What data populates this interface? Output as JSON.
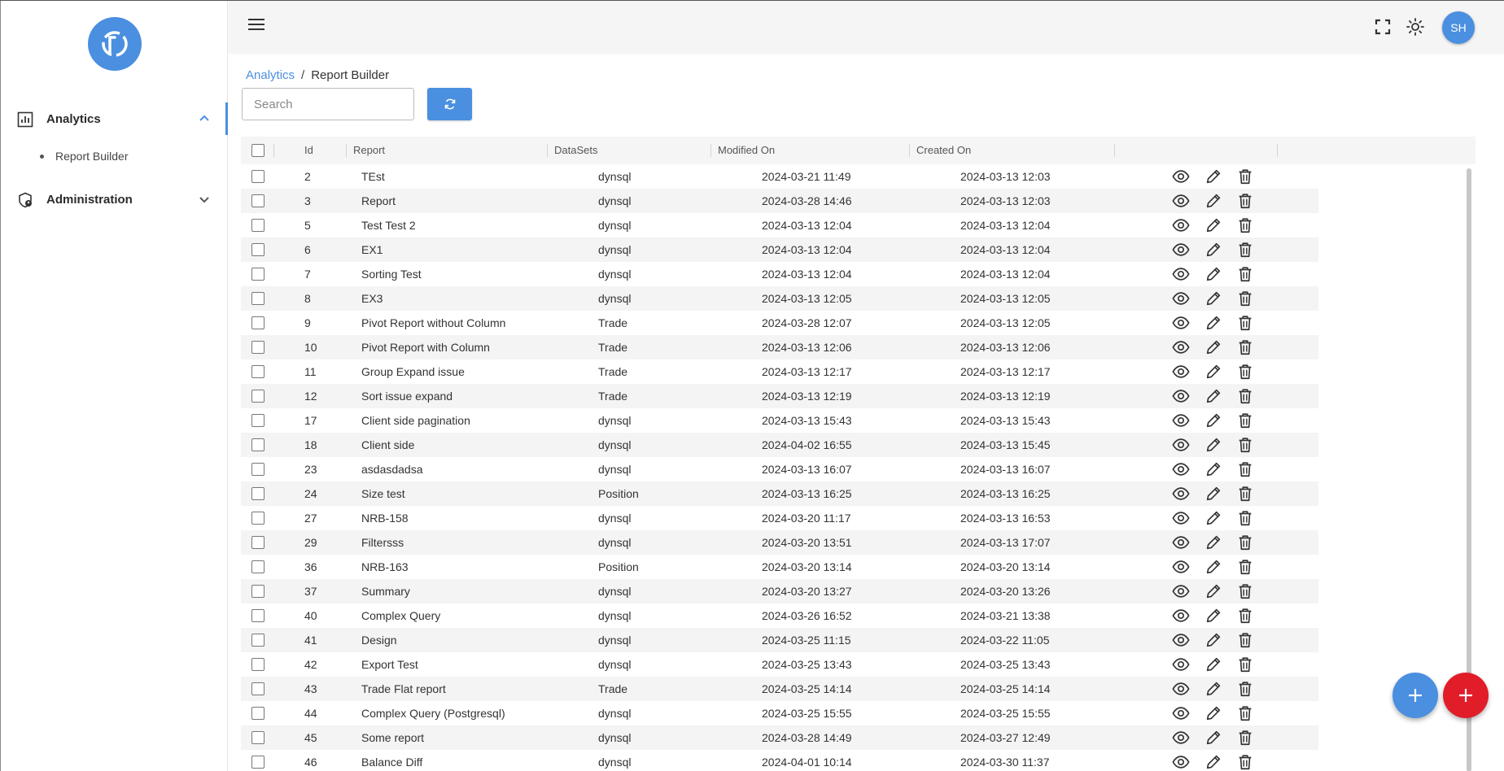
{
  "app": {
    "logo_icon": "report-logo-icon",
    "accent_color": "#4a8fe0",
    "danger_color": "#e11d2a"
  },
  "sidebar": {
    "items": [
      {
        "label": "Analytics",
        "icon": "bar-chart-icon",
        "expanded": true,
        "sub": [
          {
            "label": "Report Builder"
          }
        ]
      },
      {
        "label": "Administration",
        "icon": "shield-user-icon",
        "expanded": false
      }
    ]
  },
  "header": {
    "avatar_initials": "SH",
    "icons": [
      "menu-icon",
      "fullscreen-icon",
      "theme-icon"
    ]
  },
  "breadcrumb": {
    "parent": "Analytics",
    "separator": "/",
    "current": "Report Builder"
  },
  "search": {
    "placeholder": "Search",
    "value": ""
  },
  "table": {
    "columns": [
      "Id",
      "Report",
      "DataSets",
      "Modified On",
      "Created On"
    ],
    "rows": [
      {
        "id": "2",
        "report": "TEst",
        "datasets": "dynsql",
        "modified": "2024-03-21 11:49",
        "created": "2024-03-13 12:03"
      },
      {
        "id": "3",
        "report": "Report",
        "datasets": "dynsql",
        "modified": "2024-03-28 14:46",
        "created": "2024-03-13 12:03"
      },
      {
        "id": "5",
        "report": "Test Test 2",
        "datasets": "dynsql",
        "modified": "2024-03-13 12:04",
        "created": "2024-03-13 12:04"
      },
      {
        "id": "6",
        "report": "EX1",
        "datasets": "dynsql",
        "modified": "2024-03-13 12:04",
        "created": "2024-03-13 12:04"
      },
      {
        "id": "7",
        "report": "Sorting Test",
        "datasets": "dynsql",
        "modified": "2024-03-13 12:04",
        "created": "2024-03-13 12:04"
      },
      {
        "id": "8",
        "report": "EX3",
        "datasets": "dynsql",
        "modified": "2024-03-13 12:05",
        "created": "2024-03-13 12:05"
      },
      {
        "id": "9",
        "report": "Pivot Report without Column",
        "datasets": "Trade",
        "modified": "2024-03-28 12:07",
        "created": "2024-03-13 12:05"
      },
      {
        "id": "10",
        "report": "Pivot Report with Column",
        "datasets": "Trade",
        "modified": "2024-03-13 12:06",
        "created": "2024-03-13 12:06"
      },
      {
        "id": "11",
        "report": "Group Expand issue",
        "datasets": "Trade",
        "modified": "2024-03-13 12:17",
        "created": "2024-03-13 12:17"
      },
      {
        "id": "12",
        "report": "Sort issue expand",
        "datasets": "Trade",
        "modified": "2024-03-13 12:19",
        "created": "2024-03-13 12:19"
      },
      {
        "id": "17",
        "report": "Client side pagination",
        "datasets": "dynsql",
        "modified": "2024-03-13 15:43",
        "created": "2024-03-13 15:43"
      },
      {
        "id": "18",
        "report": "Client side",
        "datasets": "dynsql",
        "modified": "2024-04-02 16:55",
        "created": "2024-03-13 15:45"
      },
      {
        "id": "23",
        "report": "asdasdadsa",
        "datasets": "dynsql",
        "modified": "2024-03-13 16:07",
        "created": "2024-03-13 16:07"
      },
      {
        "id": "24",
        "report": "Size test",
        "datasets": "Position",
        "modified": "2024-03-13 16:25",
        "created": "2024-03-13 16:25"
      },
      {
        "id": "27",
        "report": "NRB-158",
        "datasets": "dynsql",
        "modified": "2024-03-20 11:17",
        "created": "2024-03-13 16:53"
      },
      {
        "id": "29",
        "report": "Filtersss",
        "datasets": "dynsql",
        "modified": "2024-03-20 13:51",
        "created": "2024-03-13 17:07"
      },
      {
        "id": "36",
        "report": "NRB-163",
        "datasets": "Position",
        "modified": "2024-03-20 13:14",
        "created": "2024-03-20 13:14"
      },
      {
        "id": "37",
        "report": "Summary",
        "datasets": "dynsql",
        "modified": "2024-03-20 13:27",
        "created": "2024-03-20 13:26"
      },
      {
        "id": "40",
        "report": "Complex Query",
        "datasets": "dynsql",
        "modified": "2024-03-26 16:52",
        "created": "2024-03-21 13:38"
      },
      {
        "id": "41",
        "report": "Design",
        "datasets": "dynsql",
        "modified": "2024-03-25 11:15",
        "created": "2024-03-22 11:05"
      },
      {
        "id": "42",
        "report": "Export Test",
        "datasets": "dynsql",
        "modified": "2024-03-25 13:43",
        "created": "2024-03-25 13:43"
      },
      {
        "id": "43",
        "report": "Trade Flat report",
        "datasets": "Trade",
        "modified": "2024-03-25 14:14",
        "created": "2024-03-25 14:14"
      },
      {
        "id": "44",
        "report": "Complex Query (Postgresql)",
        "datasets": "dynsql",
        "modified": "2024-03-25 15:55",
        "created": "2024-03-25 15:55"
      },
      {
        "id": "45",
        "report": "Some report",
        "datasets": "dynsql",
        "modified": "2024-03-28 14:49",
        "created": "2024-03-27 12:49"
      },
      {
        "id": "46",
        "report": "Balance Diff",
        "datasets": "dynsql",
        "modified": "2024-04-01 10:14",
        "created": "2024-03-30 11:37"
      }
    ],
    "row_actions": [
      "eye-icon",
      "pencil-icon",
      "trash-icon"
    ]
  },
  "fabs": [
    {
      "icon": "plus-icon",
      "color": "#4a8fe0"
    },
    {
      "icon": "plus-icon",
      "color": "#e11d2a"
    }
  ]
}
